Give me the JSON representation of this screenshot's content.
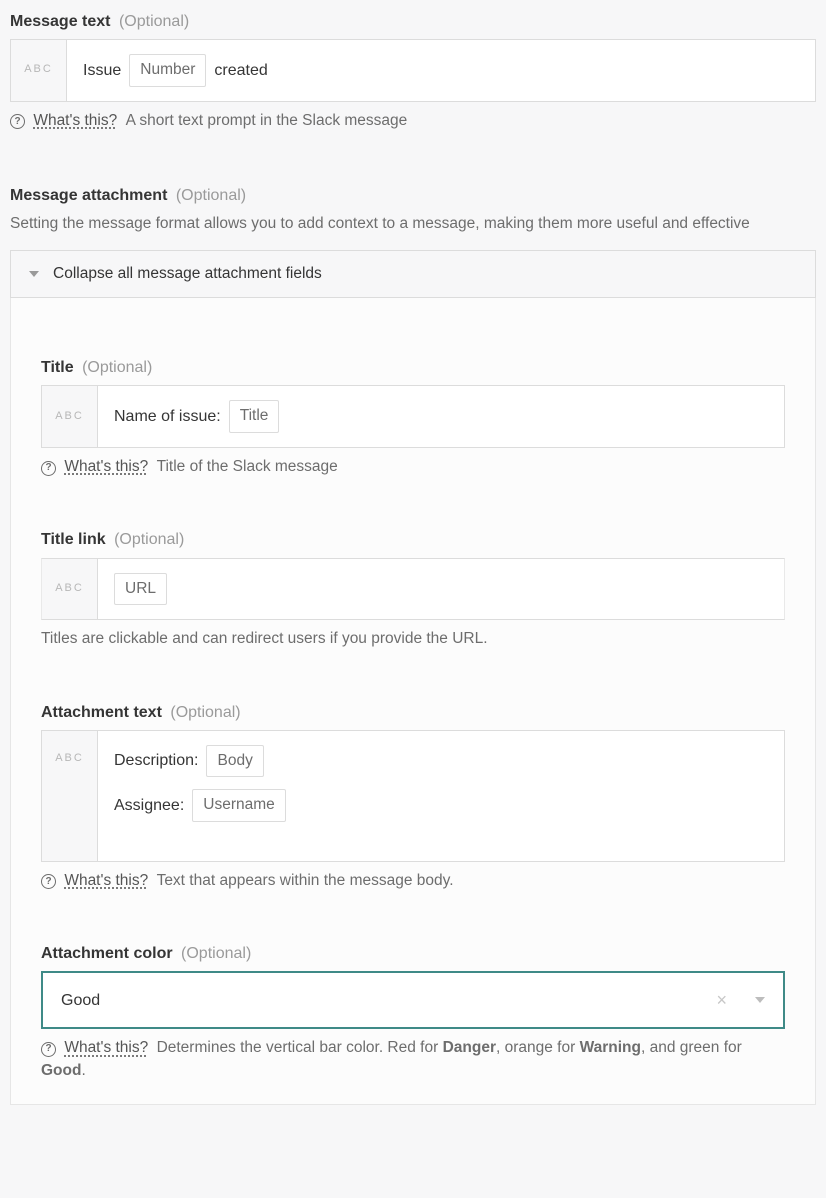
{
  "abc_label": "ABC",
  "optional_label": "(Optional)",
  "whats_this": "What's this?",
  "message_text": {
    "label": "Message text",
    "value_prefix": "Issue",
    "token": "Number",
    "value_suffix": "created",
    "help": "A short text prompt in the Slack message"
  },
  "message_attachment": {
    "label": "Message attachment",
    "desc": "Setting the message format allows you to add context to a message, making them more useful and effective",
    "collapse_label": "Collapse all message attachment fields"
  },
  "title": {
    "label": "Title",
    "value_prefix": "Name of issue:",
    "token": "Title",
    "help": "Title of the Slack message"
  },
  "title_link": {
    "label": "Title link",
    "token": "URL",
    "note": "Titles are clickable and can redirect users if you provide the URL."
  },
  "attachment_text": {
    "label": "Attachment text",
    "line1_prefix": "Description:",
    "line1_token": "Body",
    "line2_prefix": "Assignee:",
    "line2_token": "Username",
    "help": "Text that appears within the message body."
  },
  "attachment_color": {
    "label": "Attachment color",
    "value": "Good",
    "help_pre": "Determines the vertical bar color. Red for ",
    "help_b1": "Danger",
    "help_mid1": ", orange for ",
    "help_b2": "Warning",
    "help_mid2": ", and green for ",
    "help_b3": "Good",
    "help_post": "."
  }
}
